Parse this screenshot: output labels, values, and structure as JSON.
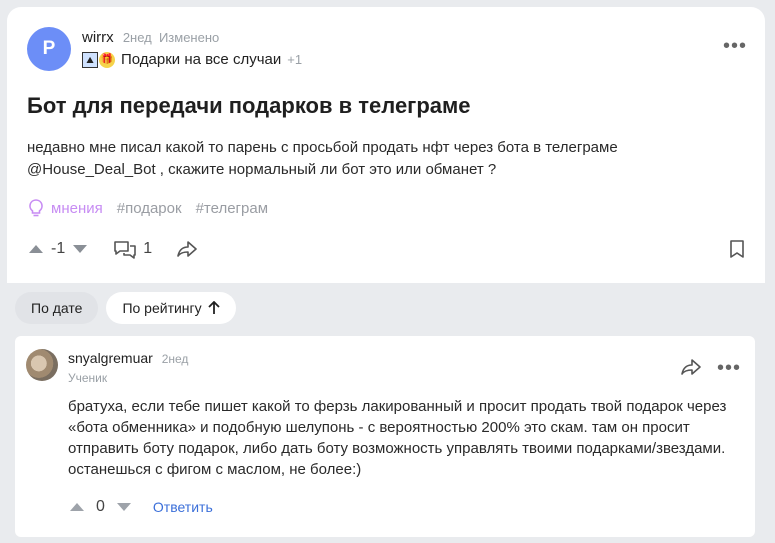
{
  "post": {
    "author_initial": "P",
    "author": "wirrx",
    "time": "2нед",
    "edited": "Изменено",
    "topic": "Подарки на все случаи",
    "topic_extra": "+1",
    "title": "Бот для передачи подарков в телеграме",
    "body": "недавно мне писал какой то парень с просьбой продать нфт через бота в телеграме @House_Deal_Bot , скажите нормальный ли бот это или обманет ?",
    "tags": [
      "мнения",
      "#подарок",
      "#телеграм"
    ],
    "score": "-1",
    "comments_count": "1"
  },
  "sort": {
    "by_date": "По дате",
    "by_rating": "По рейтингу"
  },
  "comment": {
    "author": "snyalgremuar",
    "time": "2нед",
    "role": "Ученик",
    "text": "братуха, если тебе пишет какой то ферзь лакированный и просит продать твой подарок через «бота обменника»  и подобную шелупонь - с вероятностью 200% это скам. там он просит отправить боту подарок, либо дать боту возможность управлять твоими подарками/звездами. останешься с фигом с маслом, не более:)",
    "score": "0",
    "reply_label": "Ответить"
  },
  "colors": {
    "avatar": "#6c8ef7",
    "accent_link": "#3b6fd9",
    "tag_opinion": "#c78cf3"
  }
}
